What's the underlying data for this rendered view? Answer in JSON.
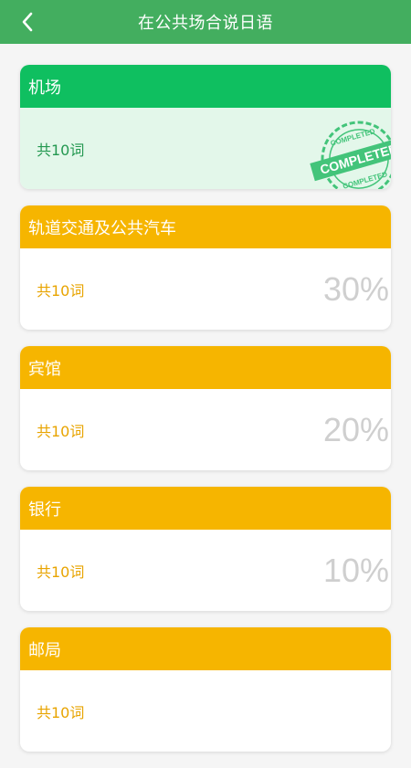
{
  "header": {
    "title": "在公共场合说日语",
    "back_icon": "chevron-left-icon"
  },
  "colors": {
    "header": "#43ae5f",
    "completed_head": "#0fbf60",
    "completed_body": "#e3f7ea",
    "completed_text": "#239850",
    "pending_head": "#f6b500",
    "pending_text": "#e8a400",
    "percent_text": "#cfcfcf"
  },
  "cards": [
    {
      "title": "机场",
      "count": "共10词",
      "status": "completed",
      "stamp_text": "COMPLETED",
      "stamp_icon": "completed-stamp-icon"
    },
    {
      "title": "轨道交通及公共汽车",
      "count": "共10词",
      "status": "in-progress",
      "percent": "30%"
    },
    {
      "title": "宾馆",
      "count": "共10词",
      "status": "in-progress",
      "percent": "20%"
    },
    {
      "title": "银行",
      "count": "共10词",
      "status": "in-progress",
      "percent": "10%"
    },
    {
      "title": "邮局",
      "count": "共10词",
      "status": "in-progress",
      "percent": ""
    }
  ]
}
